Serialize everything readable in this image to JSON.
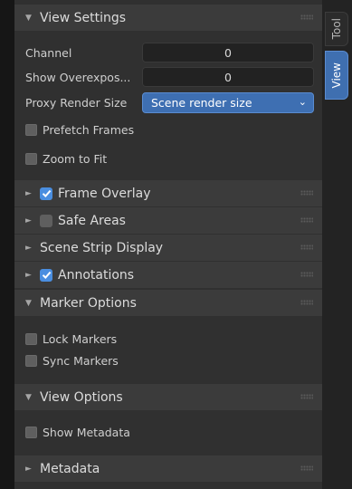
{
  "tabs": {
    "tool": "Tool",
    "view": "View"
  },
  "view_settings": {
    "header": "View Settings",
    "channel": {
      "label": "Channel",
      "value": "0"
    },
    "show_overexposed": {
      "label": "Show Overexpos...",
      "value": "0"
    },
    "proxy_render_size": {
      "label": "Proxy Render Size",
      "value": "Scene render size"
    },
    "prefetch_frames": "Prefetch Frames",
    "zoom_to_fit": "Zoom to Fit"
  },
  "frame_overlay": {
    "label": "Frame Overlay",
    "checked": true
  },
  "safe_areas": {
    "label": "Safe Areas",
    "checked": false
  },
  "scene_strip_display": {
    "label": "Scene Strip Display"
  },
  "annotations": {
    "label": "Annotations",
    "checked": true
  },
  "marker_options": {
    "header": "Marker Options",
    "lock_markers": "Lock Markers",
    "sync_markers": "Sync Markers"
  },
  "view_options": {
    "header": "View Options",
    "show_metadata": "Show Metadata"
  },
  "metadata": {
    "label": "Metadata"
  },
  "icons": {
    "expanded": "triangle-down-icon",
    "collapsed": "triangle-right-icon",
    "grip": "drag-grip-icon",
    "check": "checkmark-icon",
    "dropdown": "chevron-down-icon"
  },
  "colors": {
    "accent": "#3e6fb2",
    "checkbox_checked": "#4a8ee0",
    "panel_bg": "#303030",
    "header_bg": "#3b3b3b"
  }
}
